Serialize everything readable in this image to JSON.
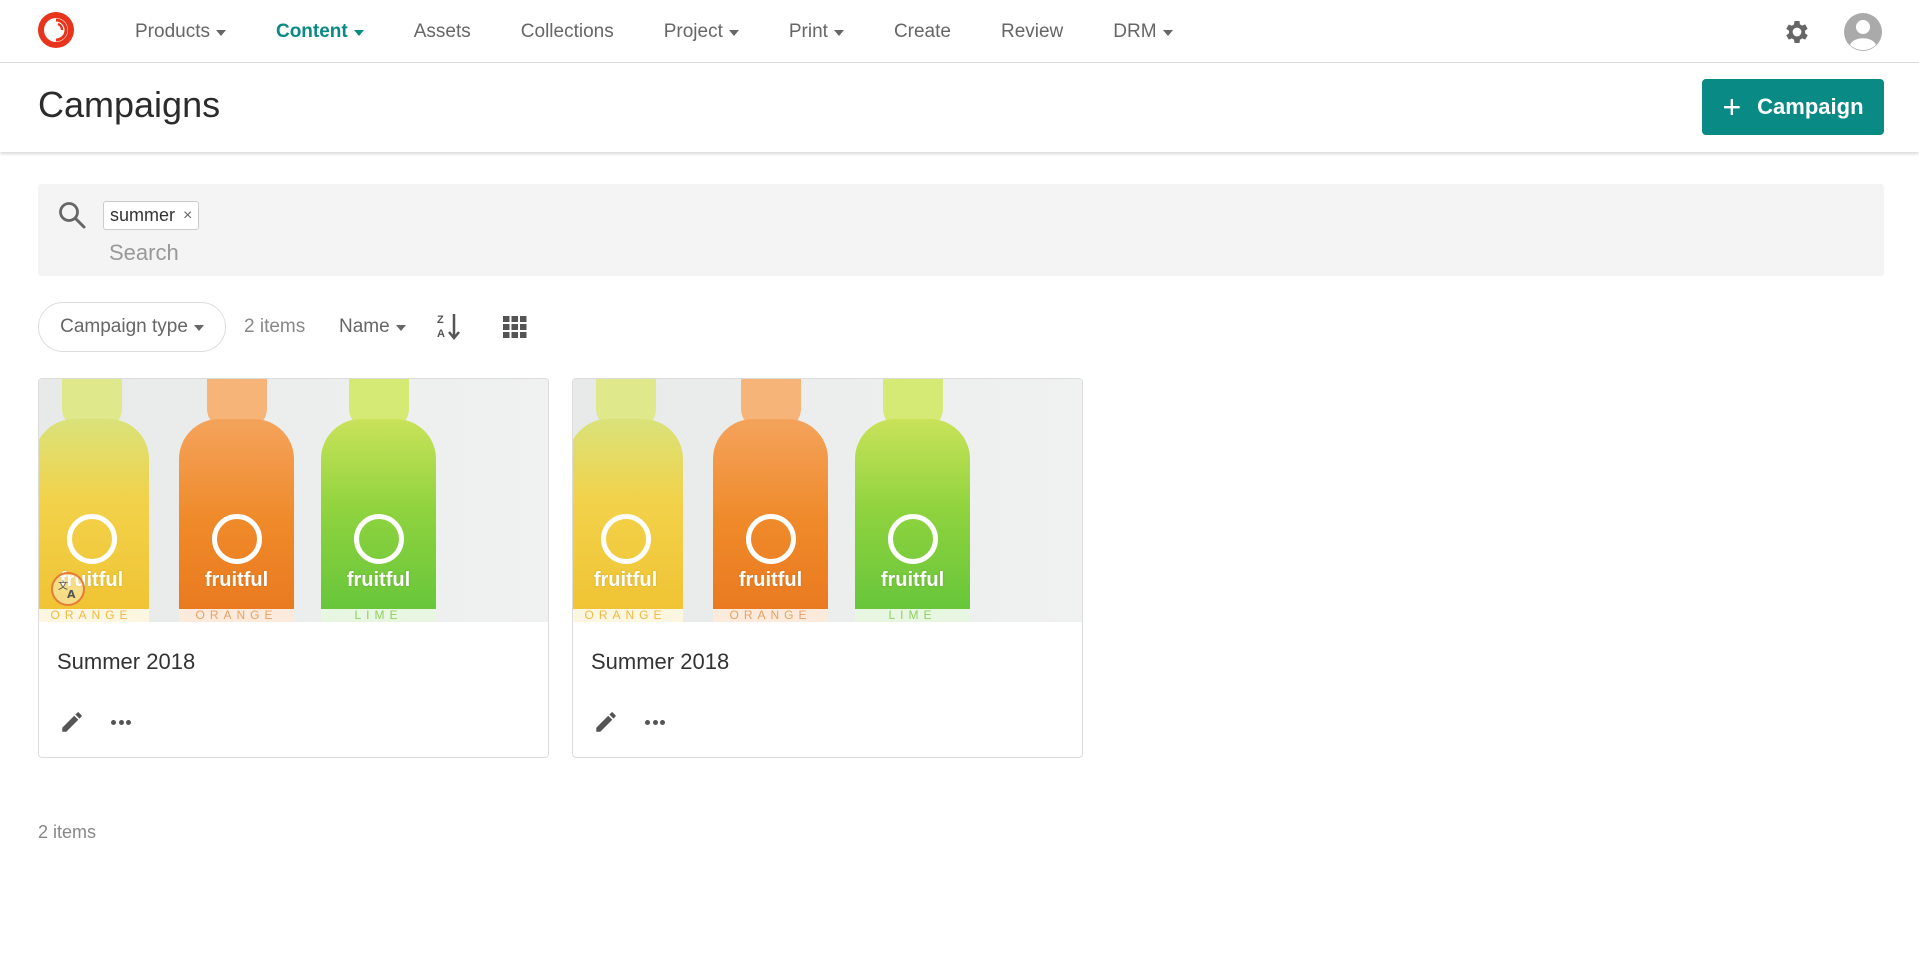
{
  "nav": {
    "items": [
      {
        "label": "Products",
        "dropdown": true,
        "active": false
      },
      {
        "label": "Content",
        "dropdown": true,
        "active": true
      },
      {
        "label": "Assets",
        "dropdown": false,
        "active": false
      },
      {
        "label": "Collections",
        "dropdown": false,
        "active": false
      },
      {
        "label": "Project",
        "dropdown": true,
        "active": false
      },
      {
        "label": "Print",
        "dropdown": true,
        "active": false
      },
      {
        "label": "Create",
        "dropdown": false,
        "active": false
      },
      {
        "label": "Review",
        "dropdown": false,
        "active": false
      },
      {
        "label": "DRM",
        "dropdown": true,
        "active": false
      }
    ],
    "logo_icon": "sitecore-logo-icon",
    "settings_icon": "gear-icon",
    "user_icon": "user-avatar-icon"
  },
  "header": {
    "title": "Campaigns",
    "add_button_label": "Campaign",
    "add_button_icon": "plus-icon"
  },
  "search": {
    "chip_label": "summer",
    "chip_remove": "×",
    "placeholder": "Search"
  },
  "toolbar": {
    "filter_label": "Campaign type",
    "items_count": "2 items",
    "sort_label": "Name",
    "sort_direction_icon": "sort-z-a-icon",
    "view_icon": "grid-view-icon"
  },
  "cards": [
    {
      "title": "Summer 2018",
      "has_translate_badge": true
    },
    {
      "title": "Summer 2018",
      "has_translate_badge": false
    }
  ],
  "bottle_labels": {
    "brand": "fruitful",
    "flavors": [
      "ORANGE",
      "ORANGE",
      "LIME"
    ]
  },
  "footer": {
    "items_count": "2 items"
  },
  "colors": {
    "accent": "#0a8a85",
    "logo": "#e8341c"
  }
}
